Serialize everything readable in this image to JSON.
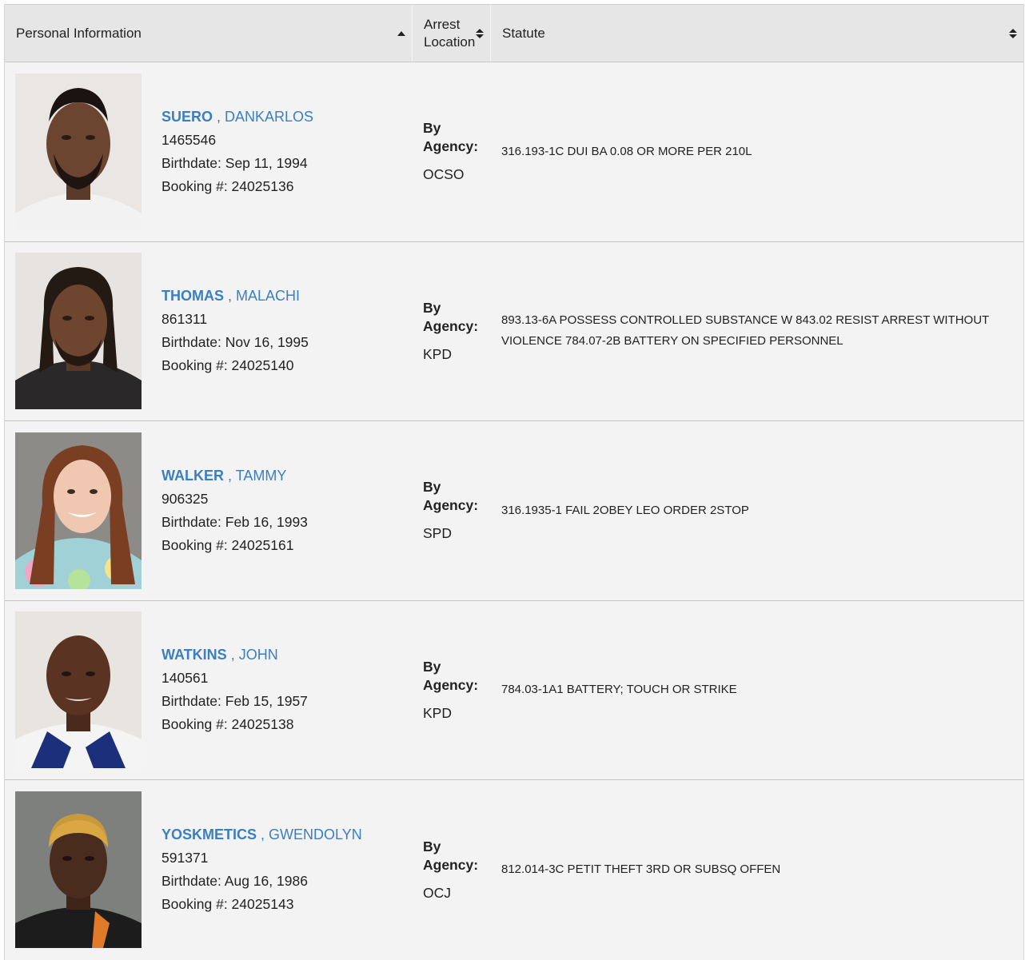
{
  "headers": {
    "personal": "Personal Information",
    "location": "Arrest Location",
    "statute": "Statute"
  },
  "rows": [
    {
      "last": "SUERO",
      "first": ", DANKARLOS",
      "id": "1465546",
      "birthdate": "Birthdate: Sep 11, 1994",
      "booking": "Booking #: 24025136",
      "by_label": "By Agency:",
      "agency": "OCSO",
      "statute": "316.193-1C DUI BA 0.08 OR MORE PER 210L"
    },
    {
      "last": "THOMAS",
      "first": ", MALACHI",
      "id": "861311",
      "birthdate": "Birthdate: Nov 16, 1995",
      "booking": "Booking #: 24025140",
      "by_label": "By Agency:",
      "agency": "KPD",
      "statute": "893.13-6A POSSESS CONTROLLED SUBSTANCE W 843.02 RESIST ARREST WITHOUT VIOLENCE 784.07-2B BATTERY ON SPECIFIED PERSONNEL"
    },
    {
      "last": "WALKER",
      "first": ", TAMMY",
      "id": "906325",
      "birthdate": "Birthdate: Feb 16, 1993",
      "booking": "Booking #: 24025161",
      "by_label": "By Agency:",
      "agency": "SPD",
      "statute": "316.1935-1 FAIL 2OBEY LEO ORDER 2STOP"
    },
    {
      "last": "WATKINS",
      "first": ", JOHN",
      "id": "140561",
      "birthdate": "Birthdate: Feb 15, 1957",
      "booking": "Booking #: 24025138",
      "by_label": "By Agency:",
      "agency": "KPD",
      "statute": "784.03-1A1 BATTERY; TOUCH OR STRIKE"
    },
    {
      "last": "YOSKMETICS",
      "first": ", GWENDOLYN",
      "id": "591371",
      "birthdate": "Birthdate: Aug 16, 1986",
      "booking": "Booking #: 24025143",
      "by_label": "By Agency:",
      "agency": "OCJ",
      "statute": "812.014-3C PETIT THEFT 3RD OR SUBSQ OFFEN"
    }
  ],
  "colors": {
    "link": "#3a7fc1",
    "header_bg": "#e6e6e6",
    "row_bg": "#f3f3f3"
  },
  "icons": {
    "sort_asc": "sort-ascending-icon",
    "sort_both": "sort-both-icon"
  }
}
